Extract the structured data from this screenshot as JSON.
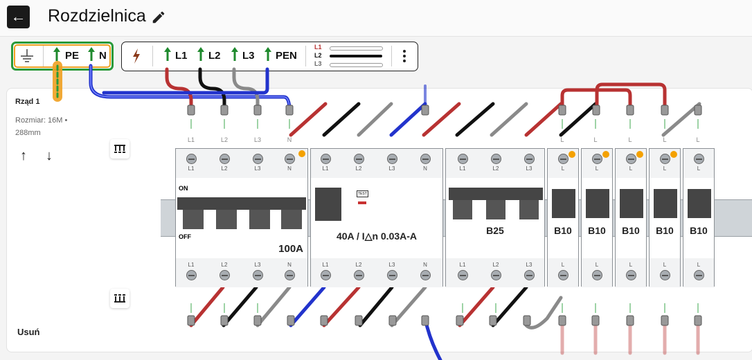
{
  "header": {
    "title": "Rozdzielnica"
  },
  "toolbar": {
    "earth_group": {
      "pe": "PE",
      "n": "N"
    },
    "phase_group": {
      "l1": "L1",
      "l2": "L2",
      "l3": "L3",
      "pen": "PEN"
    },
    "legend": {
      "l1": "L1",
      "l2": "L2",
      "l3": "L3"
    }
  },
  "row": {
    "title": "Rząd 1",
    "size_line1": "Rozmiar: 16M •",
    "size_line2": "288mm",
    "delete_label": "Usuń"
  },
  "modules": {
    "main_switch": {
      "on": "ON",
      "off": "OFF",
      "rating": "100A",
      "poles": [
        "L1",
        "L2",
        "L3",
        "N"
      ]
    },
    "rcd": {
      "test": "TEST",
      "rating": "40A / I△n 0.03A-A",
      "poles": [
        "L1",
        "L2",
        "L3",
        "N"
      ]
    },
    "b25": {
      "rating": "B25",
      "poles": [
        "L1",
        "L2",
        "L3"
      ]
    },
    "b10_1": {
      "rating": "B10",
      "pole": "L"
    },
    "b10_2": {
      "rating": "B10",
      "pole": "L"
    },
    "b10_3": {
      "rating": "B10",
      "pole": "L"
    },
    "b10_4": {
      "rating": "B10",
      "pole": "L"
    },
    "b10_5": {
      "rating": "B10",
      "pole": "L"
    }
  },
  "colors": {
    "l1": "#b83232",
    "l2": "#111111",
    "l3": "#8a8a8a",
    "n": "#2233cc",
    "pe": "#f0a020",
    "accent": "#2a9a3a"
  }
}
